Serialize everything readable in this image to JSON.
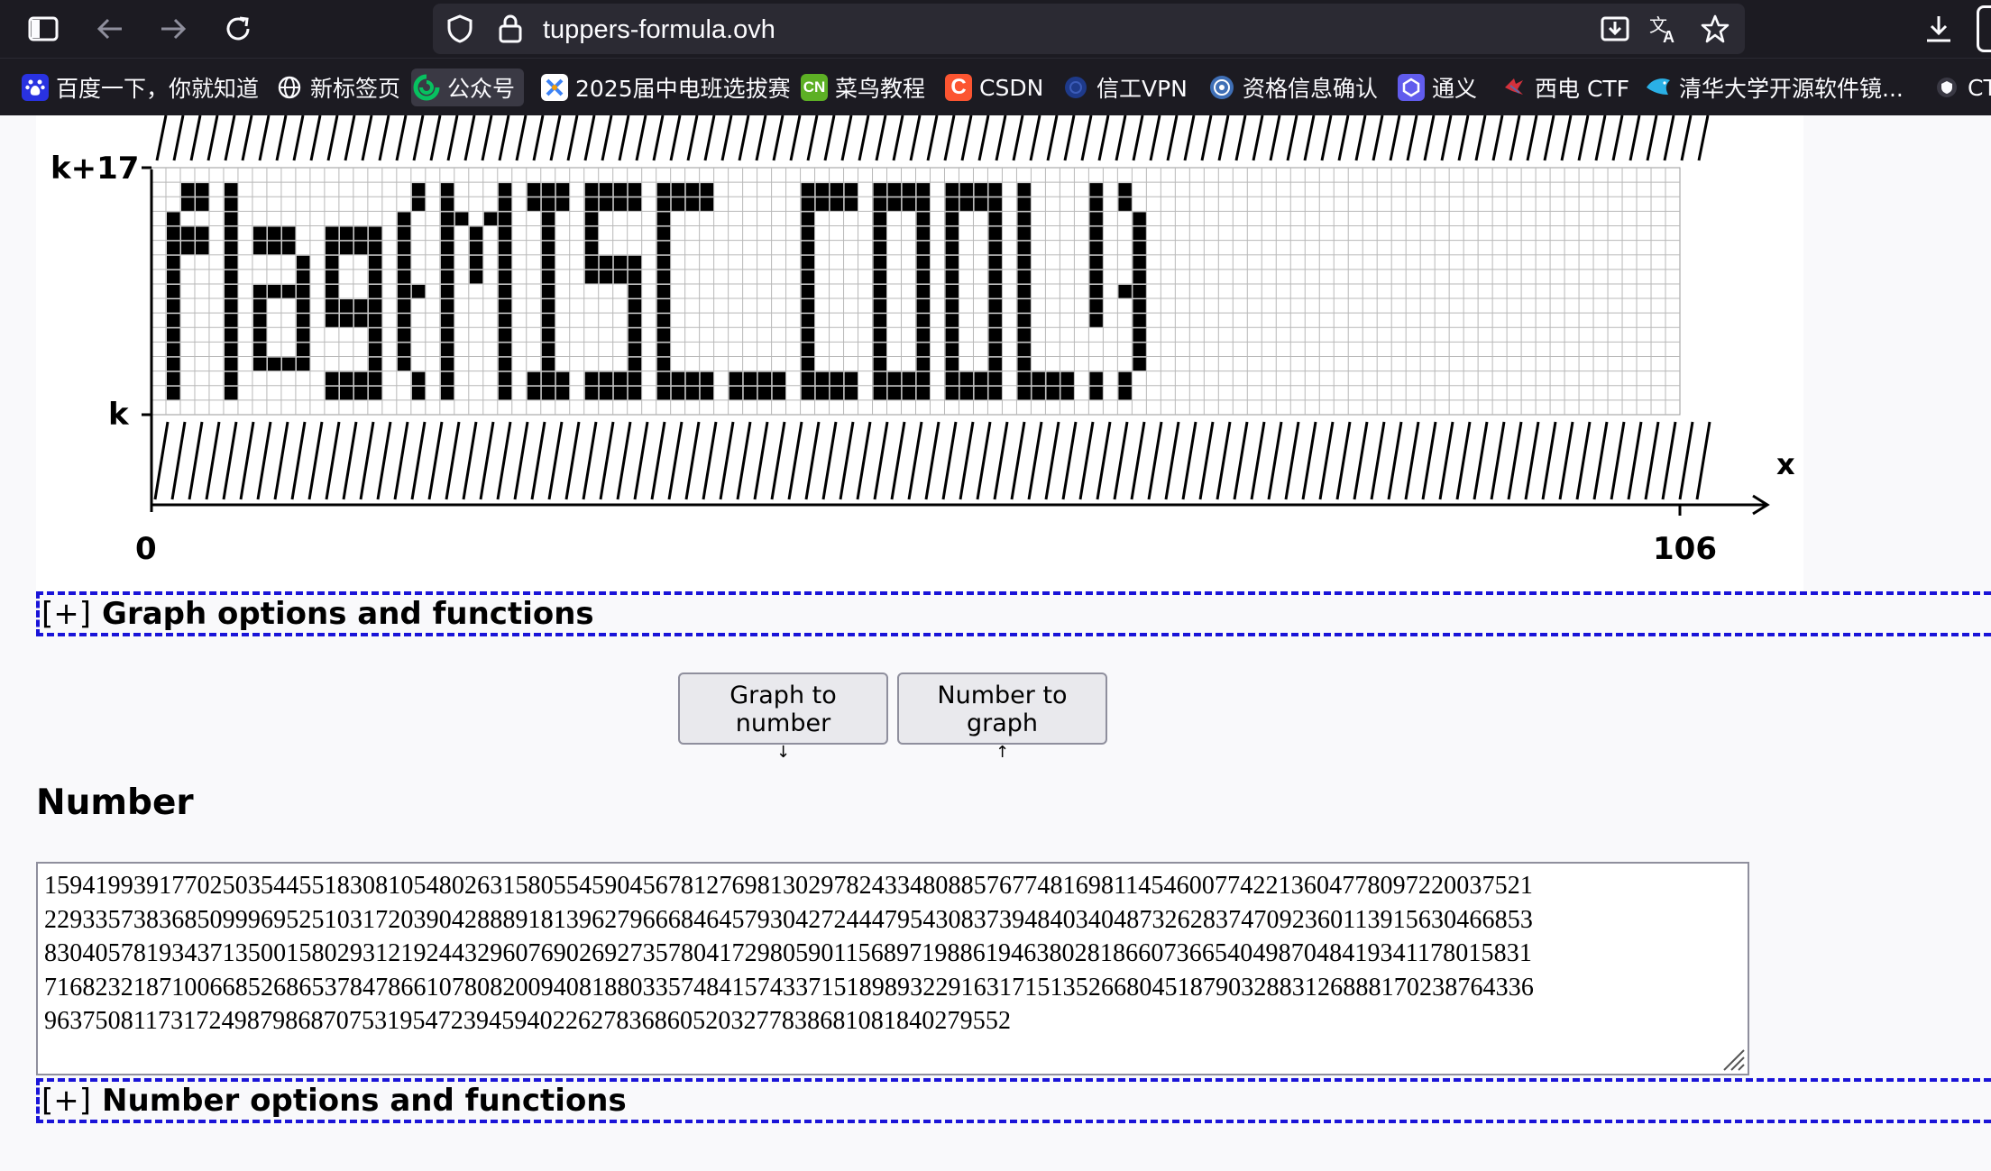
{
  "browser": {
    "url": "tuppers-formula.ovh",
    "bookmarks": [
      {
        "label": "百度一下，你就知道",
        "icon": "baidu-icon",
        "color": "#2932e1"
      },
      {
        "label": "新标签页",
        "icon": "globe-icon",
        "color": "#1c1b22"
      },
      {
        "label": "公众号",
        "icon": "wechat-icon",
        "color": "#07c160"
      },
      {
        "label": "2025届中电班选拔赛",
        "icon": "contest-icon",
        "color": "#3b82f6"
      },
      {
        "label": "菜鸟教程",
        "icon": "runoob-icon",
        "color": "#5db025",
        "glyph": "CN"
      },
      {
        "label": "CSDN",
        "icon": "csdn-icon",
        "color": "#fc5531",
        "glyph": "C"
      },
      {
        "label": "信工VPN",
        "icon": "vpn-icon",
        "color": "#1e3a8a"
      },
      {
        "label": "资格信息确认",
        "icon": "seal-icon",
        "color": "#3f6fb6"
      },
      {
        "label": "通义",
        "icon": "tongyi-icon",
        "color": "#615ced"
      },
      {
        "label": "西电 CTF",
        "icon": "ctf-icon",
        "color": "#d4313c"
      },
      {
        "label": "清华大学开源软件镜...",
        "icon": "tuna-icon",
        "color": "#2ab0e6"
      },
      {
        "label": "CT",
        "icon": "shield-bookmark-icon",
        "color": "#fbfbfe"
      }
    ]
  },
  "graph": {
    "top_label": "k+17",
    "bottom_label": "k",
    "x_axis_label": "x",
    "x_start": "0",
    "x_end": "106",
    "bitmap_text": "flag{MISC_COOL!}"
  },
  "graph_options": {
    "toggle": "[+]",
    "label": "Graph options and functions"
  },
  "buttons": {
    "graph_to_number": "Graph to number",
    "graph_to_number_arrow": "↓",
    "number_to_graph": "Number to graph",
    "number_to_graph_arrow": "↑"
  },
  "number": {
    "heading": "Number",
    "lines": [
      "15941993917702503544551830810548026315805545904567812769813029782433480885767748169811454600774221360477809722003752​1",
      "22933573836850999695251031720390428889181396279666846457930427244479543083739484034048732628374709236011391563046685​3",
      "83040578193437135001580293121924432960769026927357804172980590115689719886194638028186607366540498704841934117801583​1",
      "71682321871006685268653784786610780820094081880335748415743371518989322916317151352668045187903288312688817023876433​6",
      "963750811731724987986870753195472394594022627836860520327783868108184027955​2"
    ]
  },
  "number_options": {
    "toggle": "[+]",
    "label": "Number options and functions"
  }
}
